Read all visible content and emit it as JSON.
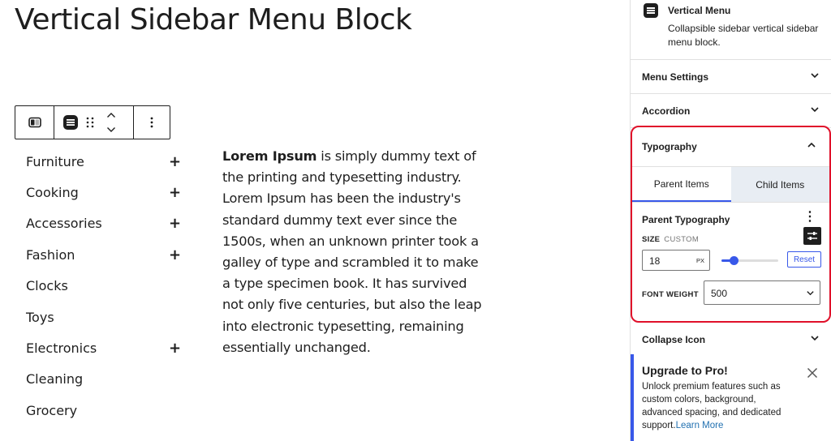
{
  "page": {
    "title": "Vertical Sidebar Menu Block"
  },
  "toolbar": {
    "icons": [
      "sidebar-toggle-icon",
      "block-menu-icon",
      "drag-handle-icon",
      "move-up-icon",
      "move-down-icon",
      "more-options-icon"
    ]
  },
  "menu": {
    "items": [
      {
        "label": "Furniture",
        "has_children": true
      },
      {
        "label": "Cooking",
        "has_children": true
      },
      {
        "label": "Accessories",
        "has_children": true
      },
      {
        "label": "Fashion",
        "has_children": true
      },
      {
        "label": "Clocks",
        "has_children": false
      },
      {
        "label": "Toys",
        "has_children": false
      },
      {
        "label": "Electronics",
        "has_children": true
      },
      {
        "label": "Cleaning",
        "has_children": false
      },
      {
        "label": "Grocery",
        "has_children": false
      }
    ],
    "expand_symbol": "+"
  },
  "paragraph": {
    "bold": "Lorem Ipsum",
    "text": " is simply dummy text of the printing and typesetting industry. Lorem Ipsum has been the industry's standard dummy text ever since the 1500s, when an unknown printer took a galley of type and scrambled it to make a type specimen book. It has survived not only five centuries, but also the leap into electronic typesetting, remaining essentially unchanged."
  },
  "sidebar": {
    "block": {
      "name": "Vertical Menu",
      "description": "Collapsible sidebar vertical sidebar menu block."
    },
    "panels": {
      "menu_settings": "Menu Settings",
      "accordion": "Accordion",
      "typography": "Typography",
      "collapse_icon": "Collapse Icon"
    },
    "typography": {
      "tabs": [
        "Parent Items",
        "Child Items"
      ],
      "active_tab": "Parent Items",
      "section_label": "Parent Typography",
      "kebab": "⋮",
      "size_label": "SIZE",
      "size_mode": "CUSTOM",
      "size_value": "18",
      "size_unit": "PX",
      "size_slider_fraction": 0.22,
      "reset_label": "Reset",
      "font_weight_label": "FONT WEIGHT",
      "font_weight_value": "500"
    },
    "upgrade": {
      "title": "Upgrade to Pro!",
      "text": "Unlock premium features such as custom colors, background, advanced spacing, and dedicated support.",
      "link": "Learn More"
    }
  },
  "colors": {
    "accent": "#3858e9",
    "highlight_border": "#e0102a",
    "inactive_tab": "#e8edf3",
    "link": "#2271b1"
  }
}
